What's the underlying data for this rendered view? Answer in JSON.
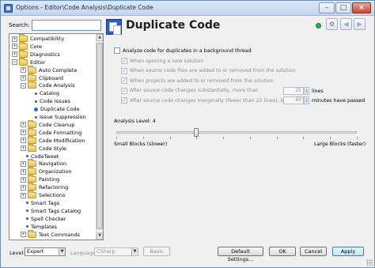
{
  "window": {
    "title": "Options - Editor\\Code Analysis\\Duplicate Code"
  },
  "search": {
    "label": "Search:",
    "value": ""
  },
  "tree": {
    "items": [
      {
        "label": "Compatibility",
        "kind": "folder",
        "expander": "+",
        "depth": 0
      },
      {
        "label": "Core",
        "kind": "folder",
        "expander": "+",
        "depth": 0
      },
      {
        "label": "Diagnostics",
        "kind": "folder",
        "expander": "+",
        "depth": 0
      },
      {
        "label": "Editor",
        "kind": "folder",
        "expander": "−",
        "depth": 0
      },
      {
        "label": "Auto Complete",
        "kind": "folder",
        "expander": "+",
        "depth": 1
      },
      {
        "label": "Clipboard",
        "kind": "folder",
        "expander": "+",
        "depth": 1
      },
      {
        "label": "Code Analysis",
        "kind": "folder",
        "expander": "−",
        "depth": 1
      },
      {
        "label": "Catalog",
        "kind": "leaf",
        "depth": 2
      },
      {
        "label": "Code Issues",
        "kind": "leaf",
        "depth": 2
      },
      {
        "label": "Duplicate Code",
        "kind": "leaf",
        "depth": 2,
        "selected": true
      },
      {
        "label": "Issue Suppression",
        "kind": "leaf",
        "depth": 2
      },
      {
        "label": "Code Cleanup",
        "kind": "folder",
        "expander": "+",
        "depth": 1
      },
      {
        "label": "Code Formatting",
        "kind": "folder",
        "expander": "+",
        "depth": 1
      },
      {
        "label": "Code Modification",
        "kind": "folder",
        "expander": "+",
        "depth": 1
      },
      {
        "label": "Code Style",
        "kind": "folder",
        "expander": "+",
        "depth": 1
      },
      {
        "label": "CodeTweet",
        "kind": "leaf",
        "depth": 1
      },
      {
        "label": "Navigation",
        "kind": "folder",
        "expander": "+",
        "depth": 1
      },
      {
        "label": "Organization",
        "kind": "folder",
        "expander": "+",
        "depth": 1
      },
      {
        "label": "Painting",
        "kind": "folder",
        "expander": "+",
        "depth": 1
      },
      {
        "label": "Refactoring",
        "kind": "folder",
        "expander": "+",
        "depth": 1
      },
      {
        "label": "Selections",
        "kind": "folder",
        "expander": "+",
        "depth": 1
      },
      {
        "label": "Smart Tags",
        "kind": "leaf",
        "depth": 1
      },
      {
        "label": "Smart Tags Catalog",
        "kind": "leaf",
        "depth": 1
      },
      {
        "label": "Spell Checker",
        "kind": "leaf",
        "depth": 1
      },
      {
        "label": "Templates",
        "kind": "leaf",
        "depth": 1
      },
      {
        "label": "Text Commands",
        "kind": "folder",
        "expander": "+",
        "depth": 1
      }
    ]
  },
  "page": {
    "title": "Duplicate Code"
  },
  "settings": {
    "main_checkbox": {
      "label": "Analyze code for duplicates in a background thread",
      "checked": false
    },
    "options": [
      {
        "label": "When opening a new solution",
        "checked": true
      },
      {
        "label": "When source code files are added to or removed from the solution",
        "checked": true
      },
      {
        "label": "When projects are added to or removed from the solution",
        "checked": true
      },
      {
        "label": "After source code changes substantially, more than",
        "checked": true,
        "value": "25",
        "suffix": "lines"
      },
      {
        "label": "After source code changes marginally (fewer than 25 lines), but",
        "checked": true,
        "value": "60",
        "suffix": "minutes have passed"
      }
    ]
  },
  "analysis": {
    "label": "Analysis Level: 4",
    "level": 4,
    "min_level": 1,
    "max_level": 10,
    "min_label": "Small Blocks (slower)",
    "max_label": "Large Blocks (faster)"
  },
  "footer": {
    "level_label": "Level:",
    "level_value": "Expert",
    "language_label": "Language:",
    "language_value": "CSharp",
    "basic_label": "Basic",
    "default_settings_label": "Default Settings...",
    "ok_label": "OK",
    "cancel_label": "Cancel",
    "apply_label": "Apply"
  },
  "colors": {
    "status": "#22b14c",
    "accent": "#3c7fb1",
    "title_bar": "#c3d7ef"
  }
}
